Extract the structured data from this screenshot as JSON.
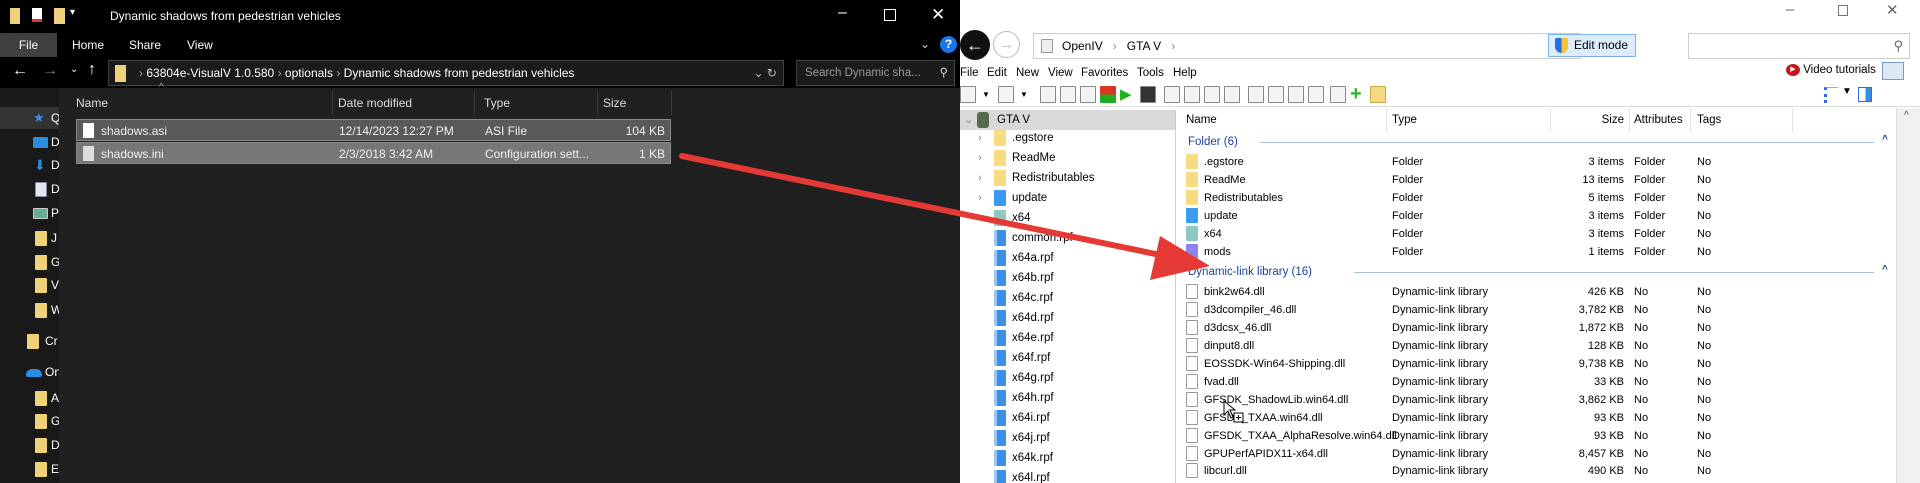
{
  "explorer": {
    "title": "Dynamic shadows from pedestrian vehicles",
    "tabs": [
      "File",
      "Home",
      "Share",
      "View"
    ],
    "breadcrumb": [
      "63804e-VisualV 1.0.580",
      "optionals",
      "Dynamic shadows from pedestrian vehicles"
    ],
    "search_placeholder": "Search Dynamic sha...",
    "columns": [
      "Name",
      "Date modified",
      "Type",
      "Size"
    ],
    "files": [
      {
        "name": "shadows.asi",
        "date": "12/14/2023 12:27 PM",
        "type": "ASI File",
        "size": "104 KB"
      },
      {
        "name": "shadows.ini",
        "date": "2/3/2018 3:42 AM",
        "type": "Configuration sett...",
        "size": "1 KB"
      }
    ],
    "nav": [
      "Qu",
      "D",
      "D",
      "D",
      "P",
      "J",
      "G",
      "V",
      "W",
      "Cr",
      "On",
      "A",
      "G",
      "D",
      "E"
    ]
  },
  "openiv": {
    "breadcrumb": [
      "OpenIV",
      "GTA V"
    ],
    "edit_mode": "Edit mode",
    "menu": [
      "File",
      "Edit",
      "New",
      "View",
      "Favorites",
      "Tools",
      "Help"
    ],
    "video_tutorials": "Video tutorials",
    "tree_root": "GTA V",
    "tree": [
      ".egstore",
      "ReadMe",
      "Redistributables",
      "update",
      "x64",
      "common.rpf",
      "x64a.rpf",
      "x64b.rpf",
      "x64c.rpf",
      "x64d.rpf",
      "x64e.rpf",
      "x64f.rpf",
      "x64g.rpf",
      "x64h.rpf",
      "x64i.rpf",
      "x64j.rpf",
      "x64k.rpf",
      "x64l.rpf"
    ],
    "columns": [
      "Name",
      "Type",
      "Size",
      "Attributes",
      "Tags"
    ],
    "groups": [
      {
        "label": "Folder (6)",
        "rows": [
          {
            "name": ".egstore",
            "type": "Folder",
            "size": "3 items",
            "attr": "Folder",
            "tags": "No",
            "color": "#f8dc83"
          },
          {
            "name": "ReadMe",
            "type": "Folder",
            "size": "13 items",
            "attr": "Folder",
            "tags": "No",
            "color": "#f8dc83"
          },
          {
            "name": "Redistributables",
            "type": "Folder",
            "size": "5 items",
            "attr": "Folder",
            "tags": "No",
            "color": "#f8dc83"
          },
          {
            "name": "update",
            "type": "Folder",
            "size": "3 items",
            "attr": "Folder",
            "tags": "No",
            "color": "#3a9bf0"
          },
          {
            "name": "x64",
            "type": "Folder",
            "size": "3 items",
            "attr": "Folder",
            "tags": "No",
            "color": "#8fc9c0"
          },
          {
            "name": "mods",
            "type": "Folder",
            "size": "1 items",
            "attr": "Folder",
            "tags": "No",
            "color": "#8a86f0"
          }
        ]
      },
      {
        "label": "Dynamic-link library (16)",
        "rows": [
          {
            "name": "bink2w64.dll",
            "type": "Dynamic-link library",
            "size": "426 KB",
            "attr": "No",
            "tags": "No"
          },
          {
            "name": "d3dcompiler_46.dll",
            "type": "Dynamic-link library",
            "size": "3,782 KB",
            "attr": "No",
            "tags": "No"
          },
          {
            "name": "d3dcsx_46.dll",
            "type": "Dynamic-link library",
            "size": "1,872 KB",
            "attr": "No",
            "tags": "No"
          },
          {
            "name": "dinput8.dll",
            "type": "Dynamic-link library",
            "size": "128 KB",
            "attr": "No",
            "tags": "No"
          },
          {
            "name": "EOSSDK-Win64-Shipping.dll",
            "type": "Dynamic-link library",
            "size": "9,738 KB",
            "attr": "No",
            "tags": "No"
          },
          {
            "name": "fvad.dll",
            "type": "Dynamic-link library",
            "size": "33 KB",
            "attr": "No",
            "tags": "No"
          },
          {
            "name": "GFSDK_ShadowLib.win64.dll",
            "type": "Dynamic-link library",
            "size": "3,862 KB",
            "attr": "No",
            "tags": "No"
          },
          {
            "name": "GFSDK_TXAA.win64.dll",
            "type": "Dynamic-link library",
            "size": "93 KB",
            "attr": "No",
            "tags": "No"
          },
          {
            "name": "GFSDK_TXAA_AlphaResolve.win64.dll",
            "type": "Dynamic-link library",
            "size": "93 KB",
            "attr": "No",
            "tags": "No"
          },
          {
            "name": "GPUPerfAPIDX11-x64.dll",
            "type": "Dynamic-link library",
            "size": "8,457 KB",
            "attr": "No",
            "tags": "No"
          },
          {
            "name": "libcurl.dll",
            "type": "Dynamic-link library",
            "size": "490 KB",
            "attr": "No",
            "tags": "No"
          }
        ]
      }
    ]
  },
  "colors": {
    "accent": "#1e3f9a",
    "arrow": "#e53935",
    "selection": "#5a5a5a",
    "hover": "#777777"
  }
}
